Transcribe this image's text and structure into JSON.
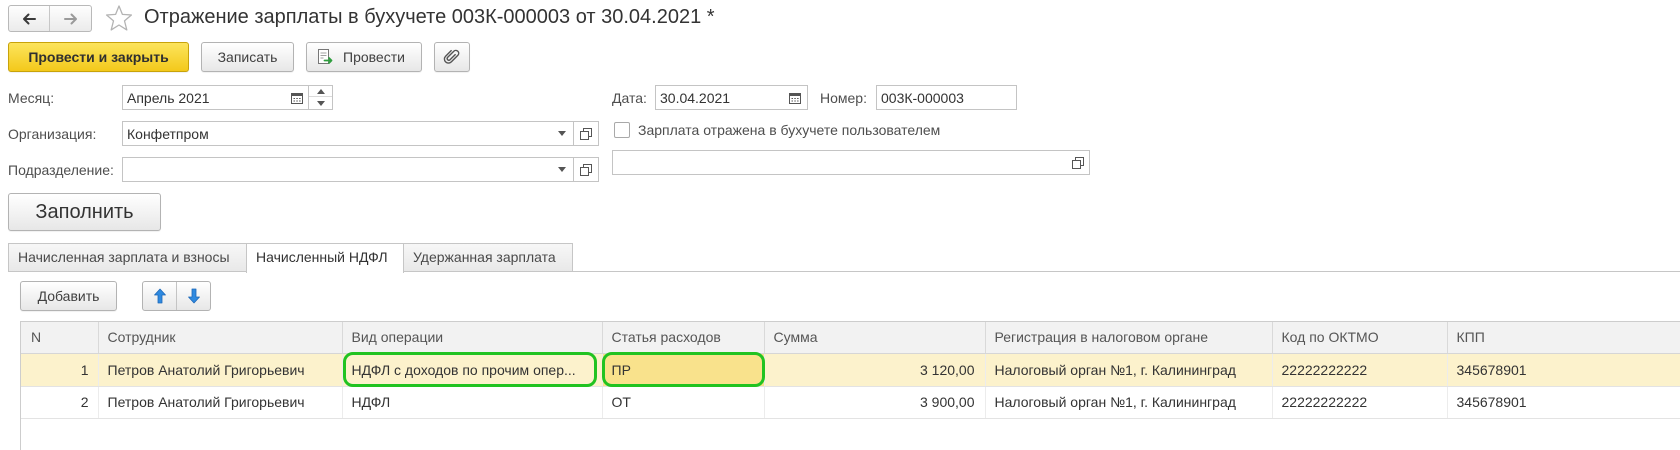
{
  "window": {
    "title": "Отражение зарплаты в бухучете 003К-000003 от 30.04.2021 *"
  },
  "toolbar": {
    "post_and_close": "Провести и закрыть",
    "save": "Записать",
    "post": "Провести"
  },
  "header_fields": {
    "month": {
      "label": "Месяц:",
      "value": "Апрель 2021"
    },
    "date": {
      "label": "Дата:",
      "value": "30.04.2021"
    },
    "number": {
      "label": "Номер:",
      "value": "003К-000003"
    },
    "organization": {
      "label": "Организация:",
      "value": "Конфетпром"
    },
    "department": {
      "label": "Подразделение:",
      "value": ""
    },
    "posted_by_user": {
      "label": "Зарплата отражена в бухучете пользователем",
      "checked": false
    },
    "extra_field": {
      "value": ""
    }
  },
  "fill_button": "Заполнить",
  "tabs": [
    {
      "label": "Начисленная зарплата и взносы",
      "active": false
    },
    {
      "label": "Начисленный НДФЛ",
      "active": true
    },
    {
      "label": "Удержанная зарплата",
      "active": false
    }
  ],
  "table_toolbar": {
    "add": "Добавить"
  },
  "table": {
    "columns": [
      "N",
      "Сотрудник",
      "Вид операции",
      "Статья расходов",
      "Сумма",
      "Регистрация в налоговом органе",
      "Код по ОКТМО",
      "КПП"
    ],
    "rows": [
      {
        "n": "1",
        "employee": "Петров Анатолий Григорьевич",
        "operation": "НДФЛ с доходов по прочим опер...",
        "expense_item": "ПР",
        "amount": "3 120,00",
        "tax_authority": "Налоговый орган №1, г. Калининград",
        "oktmo": "22222222222",
        "kpp": "345678901",
        "selected": true
      },
      {
        "n": "2",
        "employee": "Петров Анатолий Григорьевич",
        "operation": "НДФЛ",
        "expense_item": "ОТ",
        "amount": "3 900,00",
        "tax_authority": "Налоговый орган №1, г. Калининград",
        "oktmo": "22222222222",
        "kpp": "345678901",
        "selected": false
      }
    ]
  },
  "icons": {
    "back": "arrow-left-icon",
    "forward": "arrow-right-icon",
    "favorite": "star-icon",
    "post": "post-document-icon",
    "attach": "paperclip-icon",
    "calendar": "calendar-icon",
    "spin": "spin-up-down-icon",
    "dropdown": "chevron-down-icon",
    "open": "open-form-icon",
    "move_up": "arrow-up-icon",
    "move_down": "arrow-down-icon"
  },
  "colors": {
    "primary_button": "#f8d43c",
    "selected_row": "#fcf2cc",
    "current_cell": "#f9e28c",
    "highlight_outline": "#21c321",
    "move_arrows": "#2f8ae0"
  }
}
